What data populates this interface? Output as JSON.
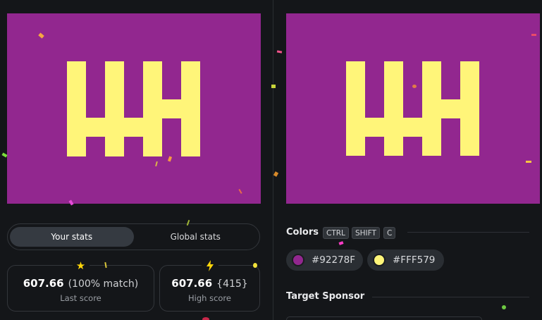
{
  "colors": {
    "background": "#92278F",
    "foreground": "#FFF579",
    "page_bg": "#141619",
    "star": "#ffd60a"
  },
  "left_panel": {
    "tabs": [
      {
        "label": "Your stats",
        "active": true
      },
      {
        "label": "Global stats",
        "active": false
      }
    ],
    "stats": [
      {
        "icon": "star-icon",
        "value": "607.66",
        "extra": "(100% match)",
        "label": "Last score"
      },
      {
        "icon": "lightning-icon",
        "value": "607.66",
        "extra": "{415}",
        "label": "High score"
      }
    ]
  },
  "right_panel": {
    "colors_title": "Colors",
    "shortcut_keys": [
      "CTRL",
      "SHIFT",
      "C"
    ],
    "swatches": [
      {
        "hex": "#92278F"
      },
      {
        "hex": "#FFF579"
      }
    ],
    "sponsor_title": "Target Sponsor"
  }
}
